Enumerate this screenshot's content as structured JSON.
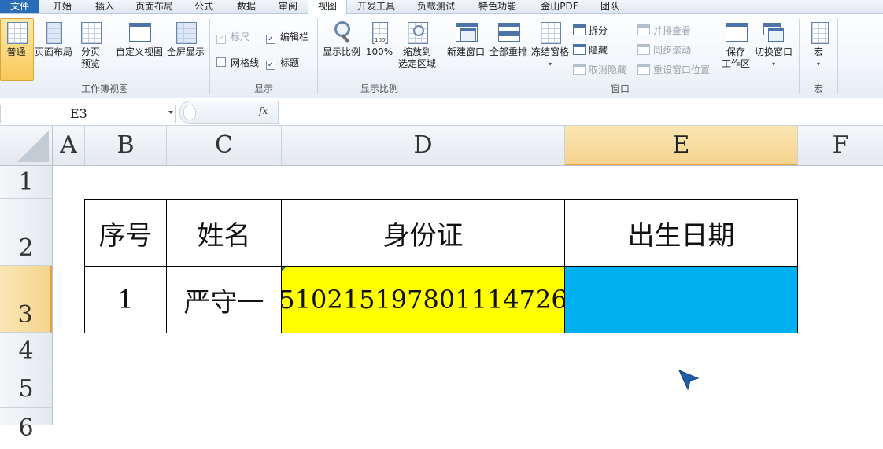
{
  "tabs": [
    "文件",
    "开始",
    "插入",
    "页面布局",
    "公式",
    "数据",
    "审阅",
    "视图",
    "开发工具",
    "负载测试",
    "特色功能",
    "金山PDF",
    "团队"
  ],
  "active_tab": "视图",
  "ribbon": {
    "workbook_views": {
      "label": "工作簿视图",
      "normal": "普通",
      "page_layout": "页面布局",
      "page_break_line1": "分页",
      "page_break_line2": "预览",
      "custom_views": "自定义视图",
      "full_screen": "全屏显示"
    },
    "show": {
      "label": "显示",
      "ruler": "标尺",
      "formula_bar": "编辑栏",
      "gridlines": "网格线",
      "headings": "标题"
    },
    "zoom": {
      "label": "显示比例",
      "zoom": "显示比例",
      "hundred": "100%",
      "zoom_sel_line1": "缩放到",
      "zoom_sel_line2": "选定区域",
      "icon_text": "100"
    },
    "window": {
      "label": "窗口",
      "new_window": "新建窗口",
      "arrange_all": "全部重排",
      "freeze_panes": "冻结窗格",
      "split": "拆分",
      "hide": "隐藏",
      "unhide": "取消隐藏",
      "side_by_side": "并排查看",
      "sync_scroll": "同步滚动",
      "reset_position": "重设窗口位置",
      "save_ws_line1": "保存",
      "save_ws_line2": "工作区",
      "switch_windows": "切换窗口"
    },
    "macros": {
      "label": "宏",
      "macros": "宏"
    }
  },
  "formula_bar": {
    "name_box": "E3",
    "fx": "fx",
    "content": ""
  },
  "columns": [
    "A",
    "B",
    "C",
    "D",
    "E",
    "F"
  ],
  "selected_column": "E",
  "rows": [
    "1",
    "2",
    "3",
    "4",
    "5",
    "6"
  ],
  "selected_row": "3",
  "table": {
    "headers": [
      "序号",
      "姓名",
      "身份证",
      "出生日期"
    ],
    "rows": [
      [
        "1",
        "严守一",
        "510215197801114726",
        ""
      ]
    ]
  },
  "colors": {
    "id_cell_fill": "#ffff00",
    "birth_cell_fill": "#00b0f0",
    "selection_accent": "#e3a23c"
  }
}
